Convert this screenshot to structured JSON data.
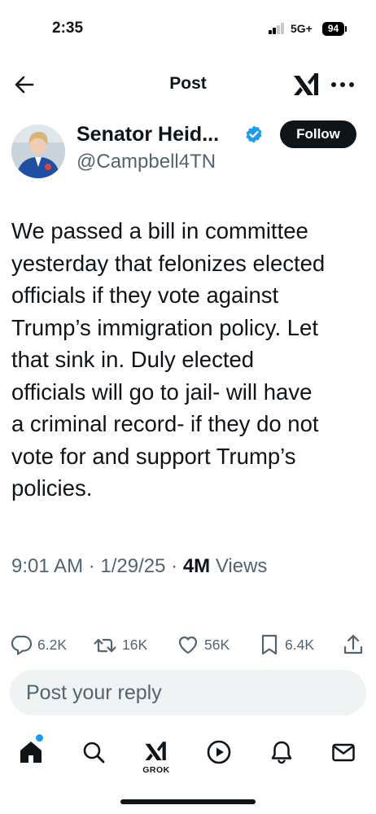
{
  "status_bar": {
    "time": "2:35",
    "network": "5G+",
    "battery": "94"
  },
  "nav": {
    "title": "Post",
    "back_icon": "arrow-left-icon",
    "brand_icon": "xai-logo-icon",
    "more_icon": "more-horizontal-icon"
  },
  "author": {
    "name": "Senator Heid...",
    "handle": "@Campbell4TN",
    "verified": true,
    "verified_color": "#1d9bf0",
    "follow_label": "Follow"
  },
  "post": {
    "lines": [
      "We passed a bill in committee",
      "yesterday that felonizes elected",
      "officials if they vote against",
      "Trump’s immigration policy. Let",
      "that sink in. Duly elected",
      "officials will go to jail- will have",
      "a criminal record- if they do not",
      "vote for and support Trump’s",
      "policies."
    ],
    "time": "9:01 AM",
    "separator": "·",
    "date": "1/29/25",
    "views_count": "4M",
    "views_label": "Views"
  },
  "actions": {
    "replies": "6.2K",
    "reposts": "16K",
    "likes": "56K",
    "bookmarks": "6.4K"
  },
  "reply": {
    "placeholder": "Post your reply"
  },
  "tabbar": {
    "grok_label": "GROK",
    "home_badge_color": "#1d9bf0"
  }
}
